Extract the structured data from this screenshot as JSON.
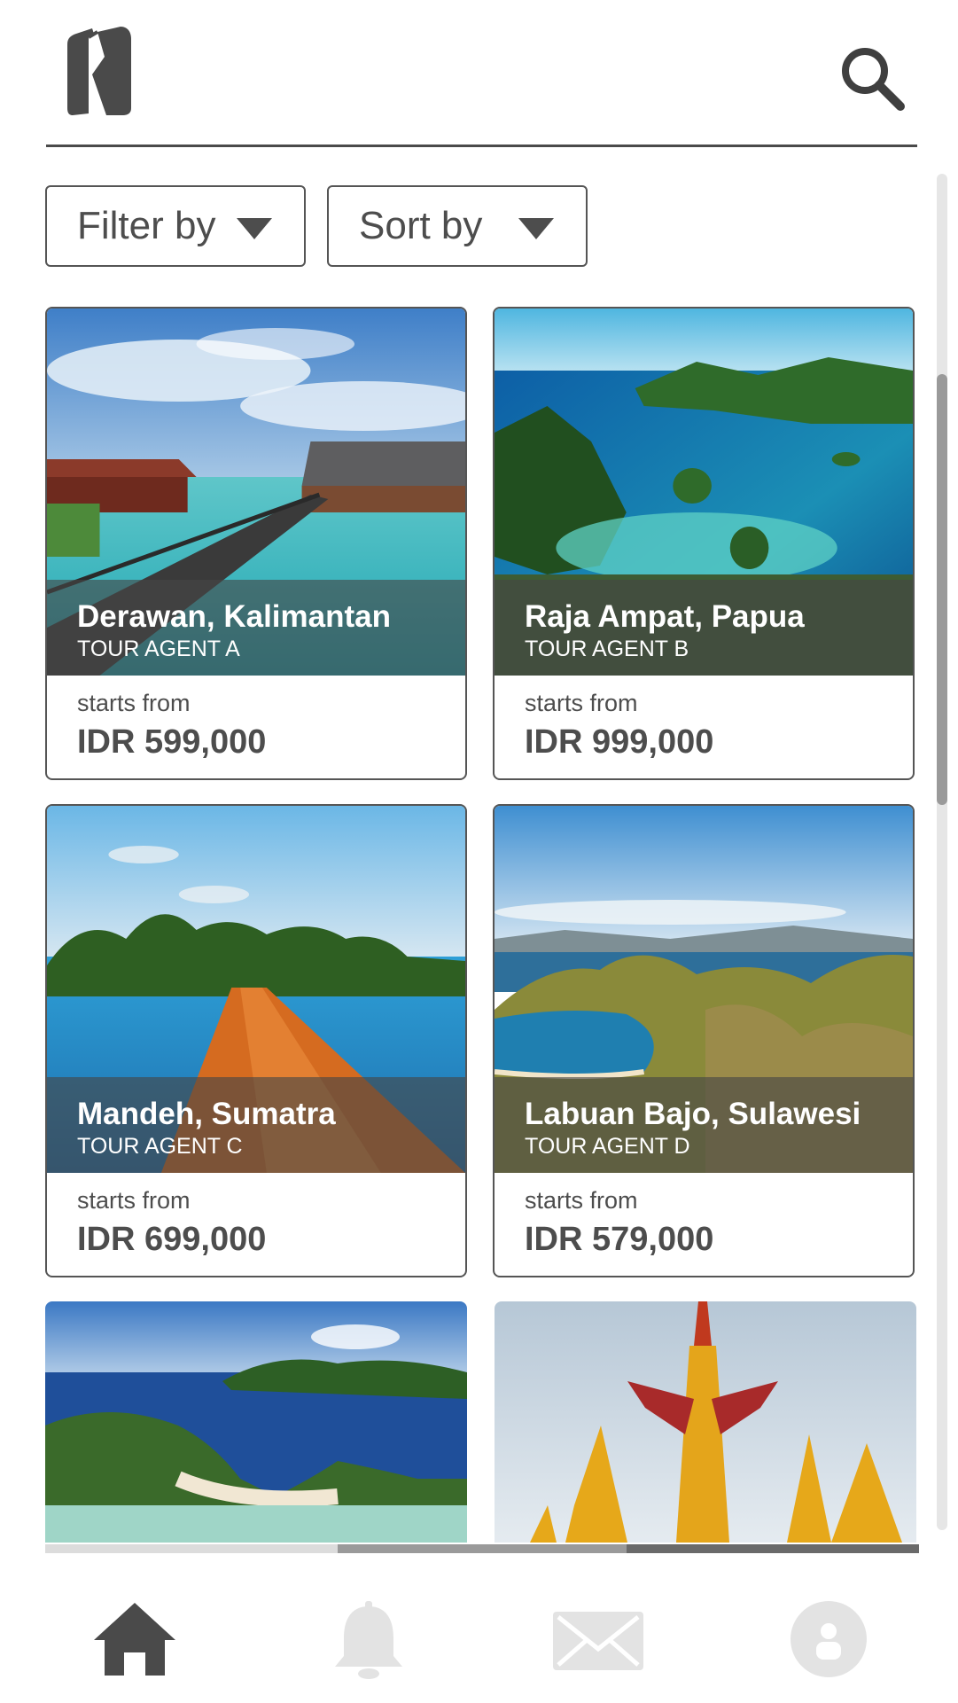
{
  "header": {
    "logo_icon": "k-logo-icon",
    "search_icon": "search-icon"
  },
  "toolbar": {
    "filter_label": "Filter by",
    "sort_label": "Sort by"
  },
  "tours": [
    {
      "name": "Derawan, Kalimantan",
      "agent": "TOUR AGENT A",
      "starts_label": "starts from",
      "price": "IDR 599,000"
    },
    {
      "name": "Raja Ampat, Papua",
      "agent": "TOUR AGENT B",
      "starts_label": "starts from",
      "price": "IDR 999,000"
    },
    {
      "name": "Mandeh, Sumatra",
      "agent": "TOUR AGENT C",
      "starts_label": "starts from",
      "price": "IDR 699,000"
    },
    {
      "name": "Labuan Bajo, Sulawesi",
      "agent": "TOUR AGENT D",
      "starts_label": "starts from",
      "price": "IDR 579,000"
    }
  ],
  "bottom_nav": {
    "items": [
      "home-icon",
      "bell-icon",
      "mail-icon",
      "profile-icon"
    ],
    "active": "home-icon",
    "active_color": "#4a4a4a",
    "inactive_color": "#e3e3e3"
  },
  "colors": {
    "text": "#4d4d4d",
    "border": "#555555",
    "overlay": "#464646"
  }
}
